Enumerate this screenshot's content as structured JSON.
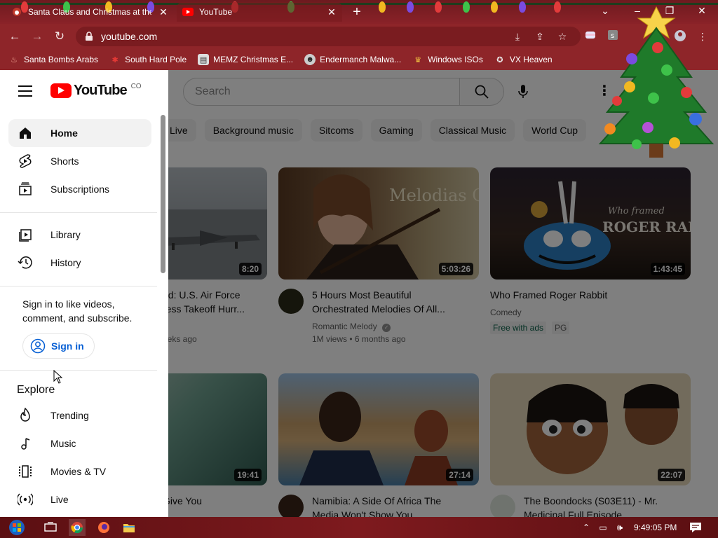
{
  "tabs": [
    {
      "title": "Santa Claus and Christmas at the",
      "active": false
    },
    {
      "title": "YouTube",
      "active": true
    }
  ],
  "address": {
    "url": "youtube.com"
  },
  "bookmarks": [
    {
      "label": "Santa Bombs Arabs"
    },
    {
      "label": "South Hard Pole"
    },
    {
      "label": "MEMZ Christmas E..."
    },
    {
      "label": "Endermanch Malwa..."
    },
    {
      "label": "Windows ISOs"
    },
    {
      "label": "VX Heaven"
    }
  ],
  "youtube": {
    "logo_text": "YouTube",
    "country_code": "CO",
    "search_placeholder": "Search",
    "chips": [
      "Live",
      "Background music",
      "Sitcoms",
      "Gaming",
      "Classical Music",
      "World Cup"
    ]
  },
  "drawer": {
    "nav": [
      {
        "label": "Home",
        "icon": "home-icon",
        "active": true
      },
      {
        "label": "Shorts",
        "icon": "shorts-icon"
      },
      {
        "label": "Subscriptions",
        "icon": "subscriptions-icon"
      },
      {
        "label": "Library",
        "icon": "library-icon"
      },
      {
        "label": "History",
        "icon": "history-icon"
      }
    ],
    "signin_prompt": "Sign in to like videos, comment, and subscribe.",
    "signin_label": "Sign in",
    "explore_heading": "Explore",
    "explore": [
      {
        "label": "Trending",
        "icon": "trending-icon"
      },
      {
        "label": "Music",
        "icon": "music-icon"
      },
      {
        "label": "Movies & TV",
        "icon": "movies-icon"
      },
      {
        "label": "Live",
        "icon": "live-icon"
      }
    ]
  },
  "videos": [
    {
      "title_line1": "ed: U.S. Air Force",
      "title_line2": "ress Takeoff Hurr...",
      "meta": "eeks ago",
      "duration": "8:20"
    },
    {
      "title_line1": "5 Hours Most Beautiful",
      "title_line2": "Orchestrated Melodies Of All...",
      "channel": "Romantic Melody",
      "meta": "1M views • 6 months ago",
      "duration": "5:03:26",
      "thumb_text": "Melodias Orquestadas"
    },
    {
      "title_line1": "Who Framed Roger Rabbit",
      "channel": "Comedy",
      "badges": [
        "Free with ads",
        "PG"
      ],
      "duration": "1:43:45",
      "thumb_text_1": "Who framed",
      "thumb_text_2": "ROGER RABBIT"
    },
    {
      "title_line1": "Give You",
      "duration": "19:41"
    },
    {
      "title_line1": "Namibia: A Side Of Africa The",
      "title_line2": "Media Won't Show You",
      "duration": "27:14"
    },
    {
      "title_line1": "The Boondocks (S03E11) - Mr.",
      "title_line2": "Medicinal Full Episode",
      "duration": "22:07"
    }
  ],
  "taskbar": {
    "time": "9:49:05 PM"
  },
  "colors": {
    "chrome": "#8e2529",
    "youtube_red": "#ff0000",
    "link_blue": "#065fd4"
  }
}
